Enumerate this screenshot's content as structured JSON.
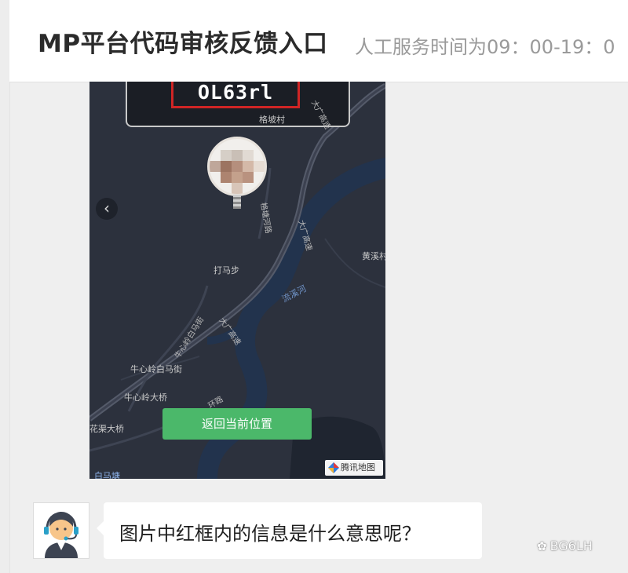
{
  "header": {
    "title": "MP平台代码审核反馈入口",
    "subtitle": "人工服务时间为09：00-19：0"
  },
  "map": {
    "plate_text": "OL63rl",
    "back_icon": "chevron-left-icon",
    "labels": {
      "village_top": "格坡村",
      "huangxi": "黄溪村",
      "damabu": "打马步",
      "liuxi_river": "流溪河",
      "baima_street": "牛心岭白马街",
      "daqiao": "牛心岭大桥",
      "huaqu_bridge": "花渠大桥",
      "baimatang": "白马塘"
    },
    "road_labels": {
      "expressway_1": "大广高速",
      "expressway_2": "大广高速",
      "expressway_3": "大广高速",
      "gepo_road": "格塘河路",
      "niuxin_road": "牛心岭白马街",
      "ring_road": "环路"
    },
    "return_button": "返回当前位置",
    "provider_logo": "腾讯地图",
    "colors": {
      "background": "#2c313d",
      "road": "#4a5060",
      "river": "#253653",
      "button": "#4bb86a",
      "plate_border": "#d02525"
    }
  },
  "chat": {
    "avatar_icon": "customer-service-agent-icon",
    "message": "图片中红框内的信息是什么意思呢？"
  },
  "watermark": {
    "icon": "wechat-icon",
    "text": "BG6LH"
  }
}
